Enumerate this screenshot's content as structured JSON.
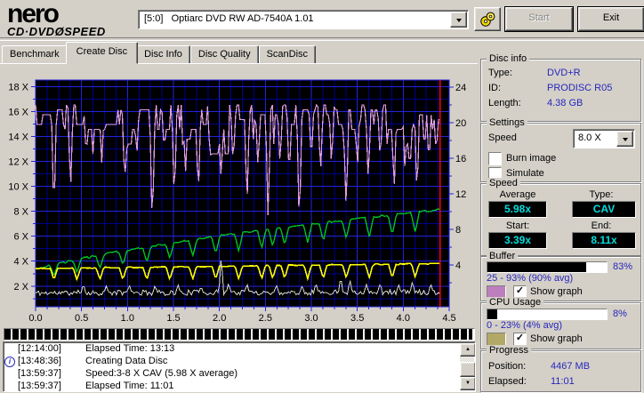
{
  "toolbar": {
    "brand_name": "nero",
    "brand_sub_left": "CD·DVD",
    "brand_sub_disc": "Ø",
    "brand_sub_right": "SPEED",
    "drive_selector_value": "[5:0]   Optiarc DVD RW AD-7540A 1.01",
    "start_label": "Start",
    "start_enabled": false,
    "exit_label": "Exit"
  },
  "tabs": [
    {
      "label": "Benchmark",
      "active": false
    },
    {
      "label": "Create Disc",
      "active": true
    },
    {
      "label": "Disc Info",
      "active": false
    },
    {
      "label": "Disc Quality",
      "active": false
    },
    {
      "label": "ScanDisc",
      "active": false
    }
  ],
  "chart_data": {
    "type": "line",
    "title": "",
    "x_axis": {
      "min": 0,
      "max": 4.5,
      "minor_tick_step": 0.125,
      "major_tick_step": 0.5,
      "tick_labels": [
        "0.0",
        "0.5",
        "1.0",
        "1.5",
        "2.0",
        "2.5",
        "3.0",
        "3.5",
        "4.0",
        "4.5"
      ]
    },
    "y_axis_left": {
      "tick_labels": [
        "18 X",
        "16 X",
        "14 X",
        "12 X",
        "10 X",
        "8 X",
        "6 X",
        "4 X",
        "2 X"
      ],
      "tick_values": [
        18,
        16,
        14,
        12,
        10,
        8,
        6,
        4,
        2
      ],
      "top_value": 18.55,
      "bottom_value": 0.34,
      "minor_step": 1,
      "major_step": 2
    },
    "y_axis_right": {
      "tick_labels": [
        "24",
        "20",
        "16",
        "12",
        "8",
        "4"
      ],
      "tick_values": [
        24,
        20,
        16,
        12,
        8,
        4
      ],
      "top_value": 24.8,
      "bottom_value": -0.7
    },
    "end_x": 4.4,
    "position_line_x": 4.4,
    "grid": true,
    "legend_position": "none",
    "colors": {
      "background": "#000000",
      "grid_minor": "#00008c",
      "grid_major": "#2323dd",
      "frame": "#2323dd",
      "position_line": "#ff0000"
    },
    "series": [
      {
        "name": "buffer-level",
        "color": "#df9fdf",
        "width": 1.2,
        "axis": "right",
        "seed": 7,
        "step": 0.016,
        "quant": 0.55,
        "hold": 0.55,
        "noise_mode": "down",
        "noise": 1.1,
        "base": [
          [
            0,
            22.3
          ],
          [
            4.4,
            22.3
          ]
        ],
        "dip_width": 0.03,
        "dips": [
          [
            0.2,
            9.2
          ],
          [
            0.38,
            12.0
          ],
          [
            0.55,
            16.5
          ],
          [
            0.72,
            15.5
          ],
          [
            0.97,
            12.5
          ],
          [
            1.1,
            16.0
          ],
          [
            1.27,
            7.4
          ],
          [
            1.4,
            16.5
          ],
          [
            1.51,
            10.8
          ],
          [
            1.63,
            14.0
          ],
          [
            1.77,
            11.2
          ],
          [
            1.9,
            15.5
          ],
          [
            2.02,
            13.0
          ],
          [
            2.15,
            15.0
          ],
          [
            2.3,
            10.4
          ],
          [
            2.42,
            14.5
          ],
          [
            2.53,
            8.7
          ],
          [
            2.66,
            15.0
          ],
          [
            2.76,
            13.5
          ],
          [
            2.87,
            7.6
          ],
          [
            3.0,
            15.5
          ],
          [
            3.1,
            14.0
          ],
          [
            3.22,
            15.0
          ],
          [
            3.38,
            9.5
          ],
          [
            3.5,
            14.5
          ],
          [
            3.62,
            13.0
          ],
          [
            3.75,
            15.5
          ],
          [
            3.9,
            11.7
          ],
          [
            4.02,
            14.0
          ],
          [
            4.15,
            11.3
          ],
          [
            4.28,
            15.0
          ],
          [
            4.36,
            16.5
          ]
        ]
      },
      {
        "name": "write-speed",
        "color": "#00c222",
        "width": 1.4,
        "axis": "left",
        "seed": 3,
        "step": 0.016,
        "hold": 0.4,
        "noise_mode": "sym",
        "noise": 0.07,
        "base": [
          [
            0,
            3.39
          ],
          [
            0.25,
            3.82
          ],
          [
            0.5,
            4.21
          ],
          [
            0.75,
            4.56
          ],
          [
            1,
            4.89
          ],
          [
            1.25,
            5.2
          ],
          [
            1.5,
            5.49
          ],
          [
            1.75,
            5.76
          ],
          [
            2,
            6.03
          ],
          [
            2.25,
            6.28
          ],
          [
            2.5,
            6.52
          ],
          [
            2.75,
            6.76
          ],
          [
            3,
            6.98
          ],
          [
            3.25,
            7.2
          ],
          [
            3.5,
            7.41
          ],
          [
            3.75,
            7.62
          ],
          [
            4,
            7.82
          ],
          [
            4.25,
            8.01
          ],
          [
            4.4,
            8.14
          ]
        ],
        "dip_width": 0.045,
        "dips": [
          [
            0.2,
            2.8
          ],
          [
            0.45,
            3.1
          ],
          [
            0.7,
            3.4
          ],
          [
            0.95,
            3.7
          ],
          [
            1.21,
            3.9
          ],
          [
            1.46,
            4.2
          ],
          [
            1.71,
            4.4
          ],
          [
            1.96,
            4.6
          ],
          [
            2.21,
            4.8
          ],
          [
            2.46,
            5.0
          ],
          [
            2.58,
            5.2
          ],
          [
            2.71,
            5.3
          ],
          [
            2.96,
            5.5
          ],
          [
            3.13,
            5.6
          ],
          [
            3.38,
            5.8
          ],
          [
            3.63,
            5.9
          ],
          [
            3.88,
            6.1
          ],
          [
            4.13,
            6.3
          ]
        ]
      },
      {
        "name": "target-speed",
        "color": "#ffff00",
        "width": 1.6,
        "axis": "left",
        "seed": 5,
        "step": 0.016,
        "hold": 0.5,
        "noise_mode": "sym",
        "noise": 0.04,
        "base": [
          [
            0,
            3.42
          ],
          [
            4.4,
            3.8
          ]
        ],
        "dip_width": 0.04,
        "dips": [
          [
            0.2,
            2.5
          ],
          [
            0.45,
            2.5
          ],
          [
            0.7,
            2.5
          ],
          [
            0.95,
            2.5
          ],
          [
            1.21,
            2.5
          ],
          [
            1.46,
            2.5
          ],
          [
            1.71,
            2.55
          ],
          [
            1.96,
            2.55
          ],
          [
            2.21,
            2.55
          ],
          [
            2.46,
            2.55
          ],
          [
            2.58,
            2.6
          ],
          [
            2.71,
            2.6
          ],
          [
            2.96,
            2.6
          ],
          [
            3.13,
            2.6
          ],
          [
            3.38,
            2.65
          ],
          [
            3.63,
            2.65
          ],
          [
            3.88,
            2.65
          ],
          [
            4.13,
            2.7
          ]
        ]
      },
      {
        "name": "cpu-usage",
        "color": "#d6d6c8",
        "width": 1,
        "axis": "right",
        "seed": 11,
        "step": 0.016,
        "hold": 0,
        "noise_mode": "sym",
        "noise": 0.3,
        "base": [
          [
            0,
            0.85
          ],
          [
            4.4,
            0.95
          ]
        ],
        "spike_width": 0.025,
        "spikes": [
          [
            0.52,
            1.9
          ],
          [
            0.77,
            1.7
          ],
          [
            1.02,
            1.8
          ],
          [
            1.3,
            1.7
          ],
          [
            1.55,
            1.8
          ],
          [
            1.8,
            1.6
          ],
          [
            2.02,
            5.2
          ],
          [
            2.1,
            2.0
          ],
          [
            2.3,
            1.9
          ],
          [
            2.62,
            1.8
          ],
          [
            2.9,
            1.7
          ],
          [
            3.05,
            2.0
          ],
          [
            3.32,
            2.7
          ],
          [
            3.42,
            2.4
          ],
          [
            3.6,
            1.8
          ],
          [
            3.75,
            2.0
          ],
          [
            3.95,
            1.8
          ],
          [
            4.1,
            2.2
          ],
          [
            4.3,
            1.9
          ]
        ]
      }
    ]
  },
  "position_strip": {
    "fill_percent": 99.6
  },
  "log": {
    "lines": [
      {
        "time": "[12:14:00]",
        "text": "Elapsed Time: 13:13",
        "icon": false
      },
      {
        "time": "[13:48:36]",
        "text": "Creating Data Disc",
        "icon": true
      },
      {
        "time": "[13:59:37]",
        "text": "Speed:3-8 X CAV (5.98 X average)",
        "icon": false
      },
      {
        "time": "[13:59:37]",
        "text": "Elapsed Time: 11:01",
        "icon": false
      }
    ]
  },
  "panels": {
    "disc_info": {
      "title": "Disc info",
      "rows": [
        {
          "label": "Type:",
          "value": "DVD+R"
        },
        {
          "label": "ID:",
          "value": "PRODISC R05"
        },
        {
          "label": "Length:",
          "value": "4.38 GB"
        }
      ]
    },
    "settings": {
      "title": "Settings",
      "speed_label": "Speed",
      "speed_value": "8.0 X",
      "burn_image_label": "Burn image",
      "burn_image_checked": false,
      "simulate_label": "Simulate",
      "simulate_checked": false
    },
    "speed": {
      "title": "Speed",
      "value_color": "#00dddd",
      "average_label": "Average",
      "average_value": "5.98x",
      "type_label": "Type:",
      "type_value": "CAV",
      "start_label": "Start:",
      "start_value": "3.39x",
      "end_label": "End:",
      "end_value": "8.11x"
    },
    "buffer": {
      "title": "Buffer",
      "percent_value": 83,
      "percent_label": "83%",
      "range_label": "25 - 93% (90% avg)",
      "swatch_color": "#bd7ebd",
      "show_graph_label": "Show graph",
      "show_graph_checked": true
    },
    "cpu": {
      "title": "CPU Usage",
      "percent_value": 8,
      "percent_label": "8%",
      "range_label": "0 - 23% (4% avg)",
      "swatch_color": "#b2a966",
      "show_graph_label": "Show graph",
      "show_graph_checked": true
    },
    "progress": {
      "title": "Progress",
      "position_label": "Position:",
      "position_value": "4467 MB",
      "elapsed_label": "Elapsed:",
      "elapsed_value": "11:01"
    }
  }
}
